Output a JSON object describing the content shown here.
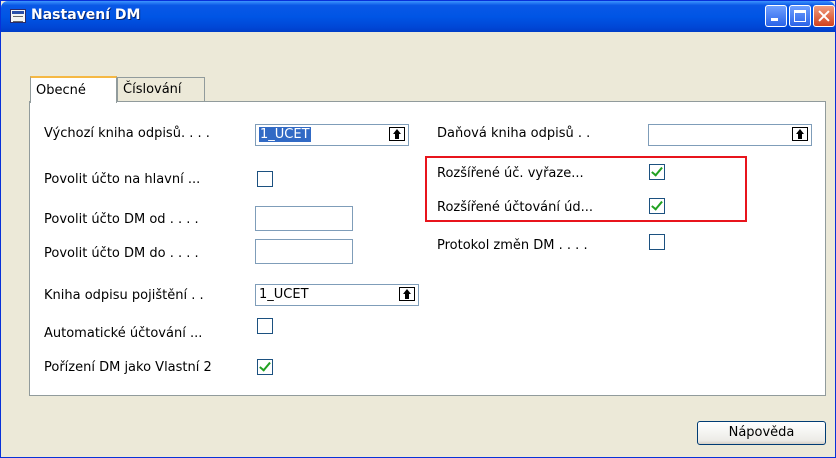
{
  "window": {
    "title": "Nastavení DM"
  },
  "tabs": [
    {
      "label": "Obecné",
      "active": true
    },
    {
      "label": "Číslování",
      "active": false
    }
  ],
  "left_fields": [
    {
      "label": "Výchozí kniha odpisů. . . .",
      "value": "1_UCET",
      "type": "lookup"
    },
    {
      "label": "Povolit účto na hlavní ...",
      "checked": false,
      "type": "checkbox"
    },
    {
      "label": "Povolit účto DM od . . . .",
      "value": "",
      "type": "text"
    },
    {
      "label": "Povolit účto DM do . . . .",
      "value": "",
      "type": "text"
    },
    {
      "label": "Kniha odpisu pojištění . .",
      "value": "1_UCET",
      "type": "lookup"
    },
    {
      "label": "Automatické účtování ...",
      "checked": false,
      "type": "checkbox"
    },
    {
      "label": "Pořízení DM jako Vlastní 2",
      "checked": true,
      "type": "checkbox"
    }
  ],
  "right_fields": [
    {
      "label": "Daňová kniha odpisů . .",
      "value": "",
      "type": "lookup"
    },
    {
      "label": "Rozšířené úč. vyřaze...",
      "checked": true,
      "type": "checkbox"
    },
    {
      "label": "Rozšířené účtování úd...",
      "checked": true,
      "type": "checkbox"
    },
    {
      "label": "Protokol změn DM . . . .",
      "checked": false,
      "type": "checkbox"
    }
  ],
  "buttons": {
    "help_label": "Nápověda"
  },
  "colors": {
    "highlight": "#E8141C",
    "selection": "#316AC5",
    "titlebar": "#0055E5"
  },
  "icons": {
    "window": "form-icon",
    "lookup": "lookup-arrow-icon"
  }
}
